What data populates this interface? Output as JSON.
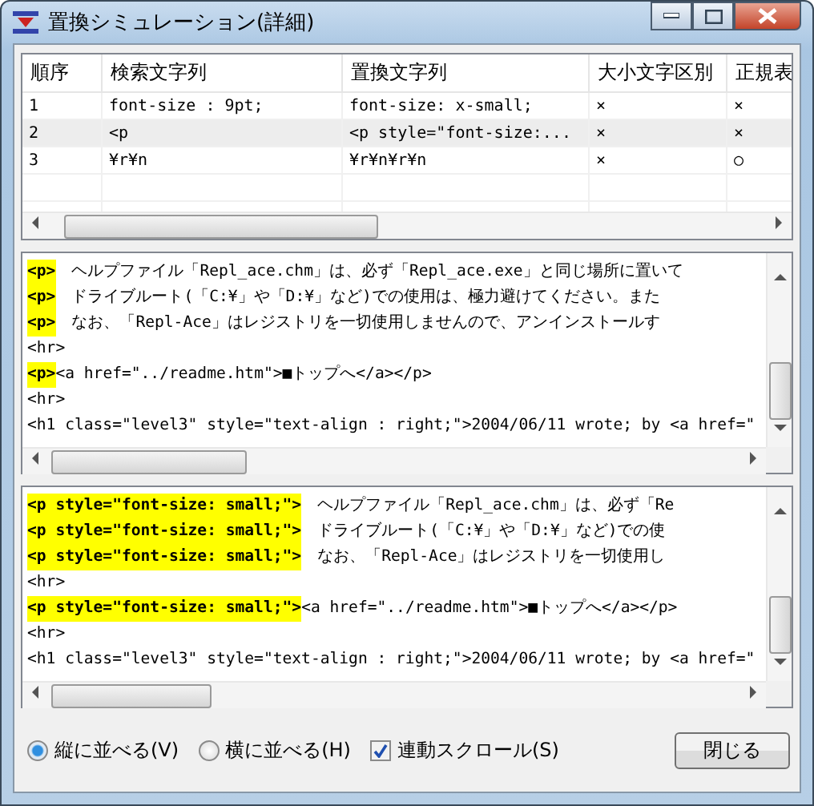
{
  "window": {
    "title": "置換シミュレーション(詳細)"
  },
  "table": {
    "columns": [
      "順序",
      "検索文字列",
      "置換文字列",
      "大小文字区別",
      "正規表"
    ],
    "rows": [
      [
        "1",
        "font-size : 9pt;",
        "font-size: x-small;",
        "×",
        "×"
      ],
      [
        "2",
        "<p",
        "<p style=\"font-size:...",
        "×",
        "×"
      ],
      [
        "3",
        "¥r¥n",
        "¥r¥n¥r¥n",
        "×",
        "○"
      ]
    ]
  },
  "before_pane": {
    "lines": [
      [
        {
          "text": "<p>",
          "highlight": true
        },
        {
          "text": "　ヘルプファイル「Repl_ace.chm」は、必ず「Repl_ace.exe」と同じ場所に置いて",
          "highlight": false
        }
      ],
      [
        {
          "text": "<p>",
          "highlight": true
        },
        {
          "text": "　ドライブルート(「C:¥」や「D:¥」など)での使用は、極力避けてください。また",
          "highlight": false
        }
      ],
      [
        {
          "text": "<p>",
          "highlight": true
        },
        {
          "text": "　なお、「Repl-Ace」はレジストリを一切使用しませんので、アンインストールす",
          "highlight": false
        }
      ],
      [
        {
          "text": "<hr>",
          "highlight": false
        }
      ],
      [
        {
          "text": "<p>",
          "highlight": true
        },
        {
          "text": "<a href=\"../readme.htm\">■トップへ</a></p>",
          "highlight": false
        }
      ],
      [
        {
          "text": "<hr>",
          "highlight": false
        }
      ],
      [
        {
          "text": "<h1 class=\"level3\" style=\"text-align : right;\">2004/06/11 wrote; by <a href=\"",
          "highlight": false
        }
      ]
    ]
  },
  "after_pane": {
    "lines": [
      [
        {
          "text": "<p style=\"font-size: small;\">",
          "highlight": true
        },
        {
          "text": "　ヘルプファイル「Repl_ace.chm」は、必ず「Re",
          "highlight": false
        }
      ],
      [
        {
          "text": "<p style=\"font-size: small;\">",
          "highlight": true
        },
        {
          "text": "　ドライブルート(「C:¥」や「D:¥」など)での使",
          "highlight": false
        }
      ],
      [
        {
          "text": "<p style=\"font-size: small;\">",
          "highlight": true
        },
        {
          "text": "　なお、「Repl-Ace」はレジストリを一切使用し",
          "highlight": false
        }
      ],
      [
        {
          "text": "<hr>",
          "highlight": false
        }
      ],
      [
        {
          "text": "<p style=\"font-size: small;\">",
          "highlight": true
        },
        {
          "text": "<a href=\"../readme.htm\">■トップへ</a></p>",
          "highlight": false
        }
      ],
      [
        {
          "text": "<hr>",
          "highlight": false
        }
      ],
      [
        {
          "text": "<h1 class=\"level3\" style=\"text-align : right;\">2004/06/11 wrote; by <a href=\"",
          "highlight": false
        }
      ]
    ]
  },
  "options": [
    {
      "kind": "radio",
      "label": "縦に並べる(V)",
      "selected": true
    },
    {
      "kind": "radio",
      "label": "横に並べる(H)",
      "selected": false
    },
    {
      "kind": "checkbox",
      "label": "連動スクロール(S)",
      "checked": true
    }
  ],
  "close_button": "閉じる"
}
